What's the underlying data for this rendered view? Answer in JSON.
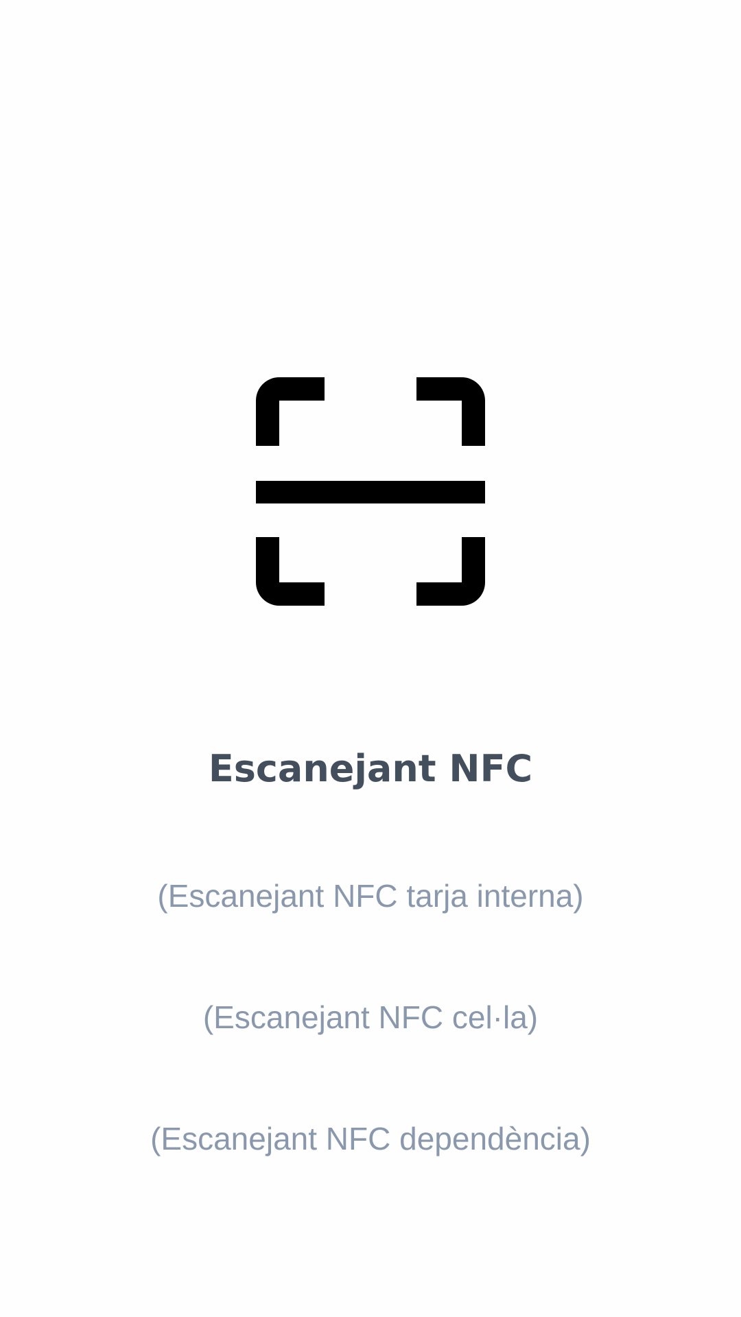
{
  "scan_screen": {
    "icon": "scan-frame-icon",
    "title": "Escanejant NFC",
    "messages": [
      "(Escanejant NFC tarja interna)",
      "(Escanejant NFC cel·la)",
      "(Escanejant NFC dependència)"
    ]
  },
  "colors": {
    "icon": "#000000",
    "title": "#444f5e",
    "message": "#8a98ad",
    "background": "#fefefe"
  }
}
